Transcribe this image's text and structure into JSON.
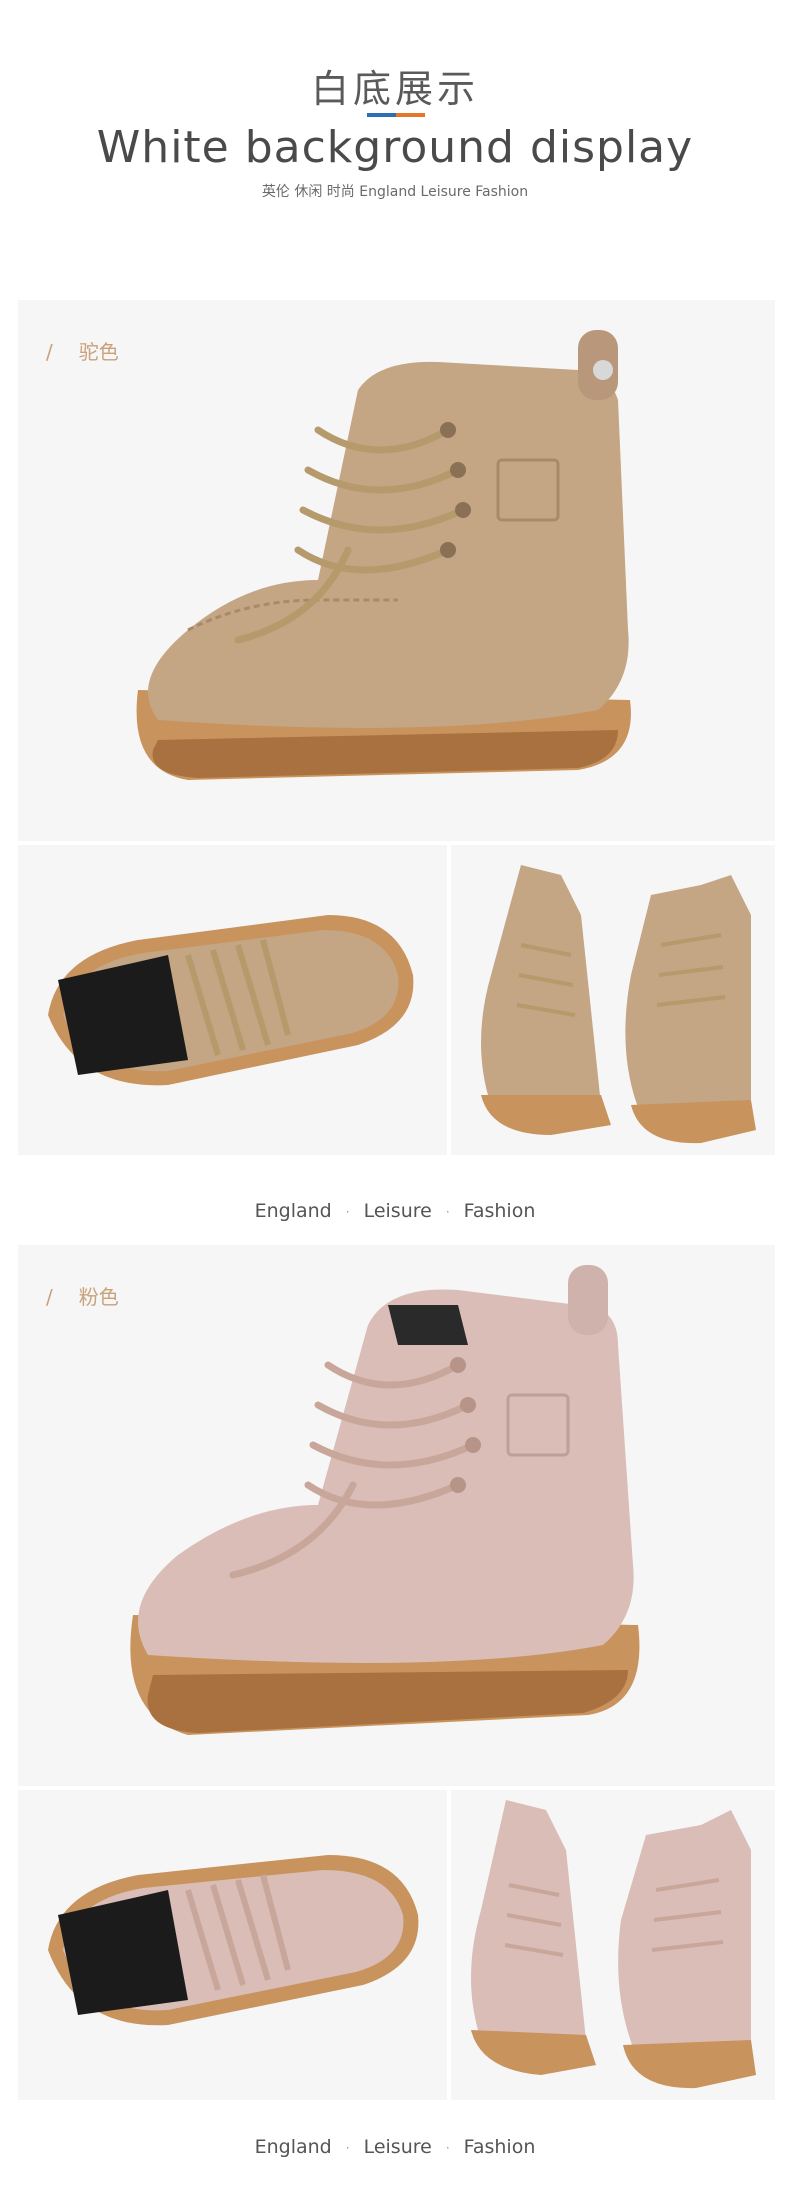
{
  "header": {
    "title_cn": "白底展示",
    "title_en": "White background display",
    "subtitle": "英伦 休闲 时尚 England Leisure Fashion",
    "divider_colors": [
      "#2d6fb7",
      "#e2762b"
    ]
  },
  "sections": [
    {
      "color_label": "驼色",
      "slash": "/",
      "boot_color": "#c4a584",
      "caption": [
        "England",
        "Leisure",
        "Fashion"
      ],
      "caption_sep": "·"
    },
    {
      "color_label": "粉色",
      "slash": "/",
      "boot_color": "#d9bdb6",
      "caption": [
        "England",
        "Leisure",
        "Fashion"
      ],
      "caption_sep": "·"
    }
  ]
}
